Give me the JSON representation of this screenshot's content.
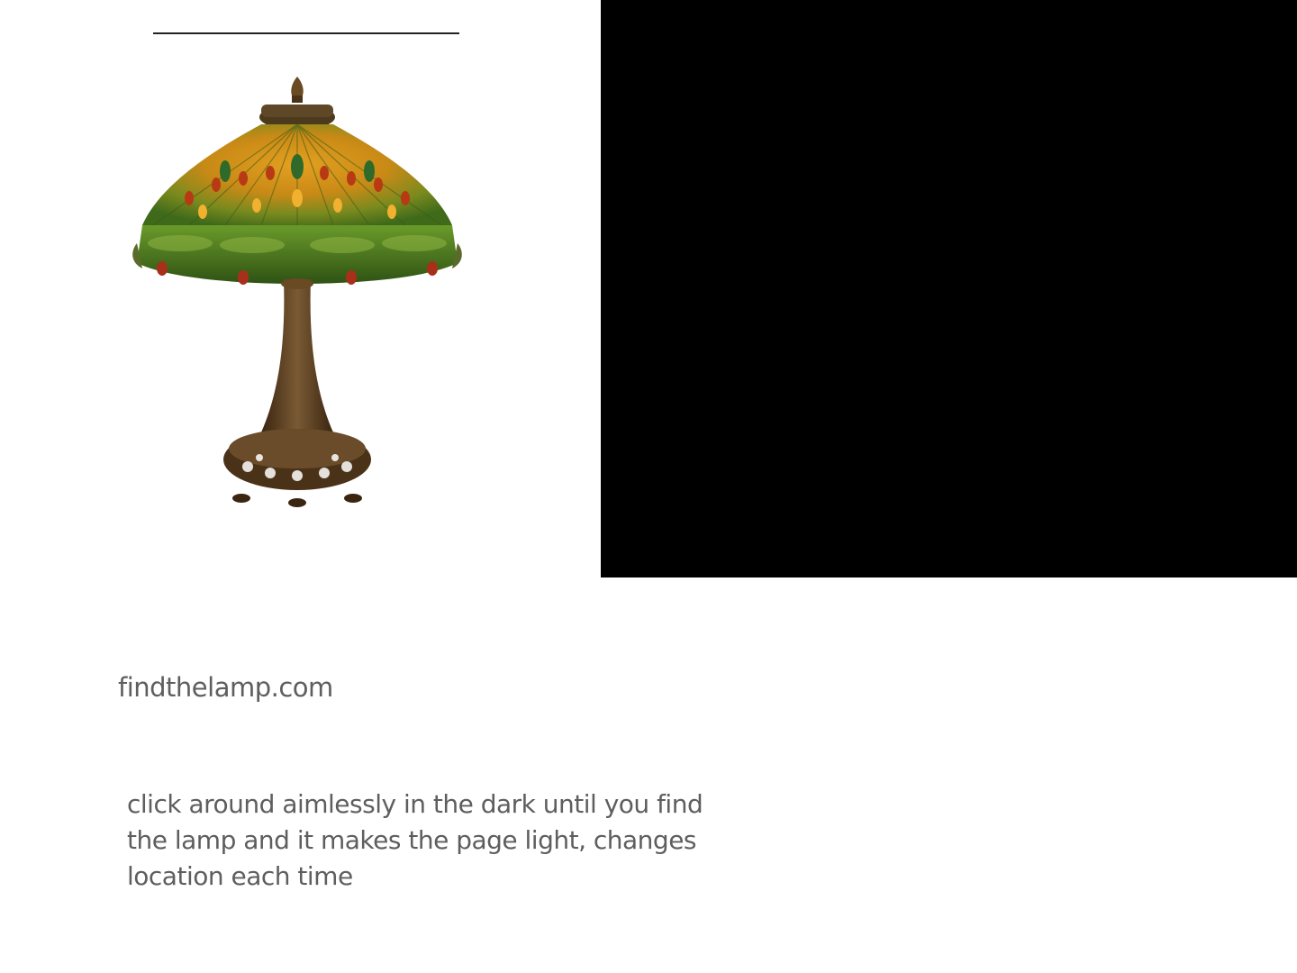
{
  "site": {
    "name": "findthelamp.com"
  },
  "description": {
    "text": "click around aimlessly in the dark until you find the lamp and it makes the page light, changes location each time"
  },
  "colors": {
    "panel_background": "#000000",
    "page_background": "#ffffff",
    "text": "#5e5e5e",
    "shade_green": "#4f7a1f",
    "shade_amber": "#c98a16",
    "bronze": "#5a3b1c"
  },
  "icons": {
    "lamp": "tiffany-dragonfly-lamp-icon"
  }
}
